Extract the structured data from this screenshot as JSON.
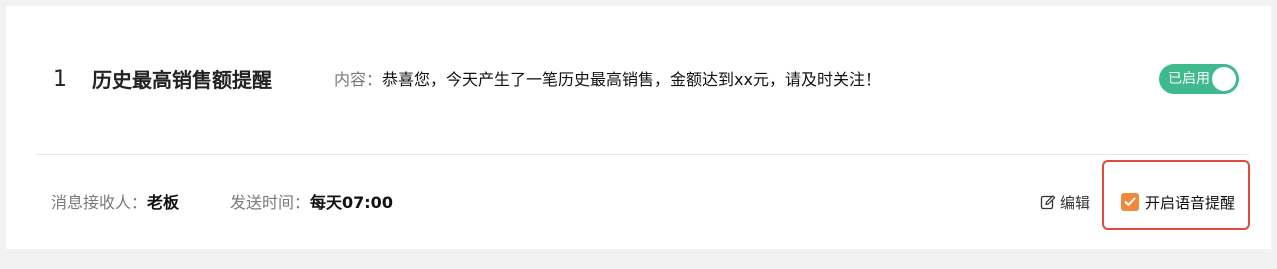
{
  "rule": {
    "index": "1",
    "title": "历史最高销售额提醒",
    "content_label": "内容：",
    "content_text": "恭喜您，今天产生了一笔历史最高销售，金额达到xx元，请及时关注！",
    "toggle_label": "已启用",
    "toggle_state": "on",
    "receiver_label": "消息接收人：",
    "receiver_value": "老板",
    "send_time_label": "发送时间：",
    "send_time_value": "每天07:00",
    "edit_label": "编辑",
    "edit_icon": "edit-icon",
    "voice_label": "开启语音提醒",
    "voice_checked": true
  },
  "colors": {
    "toggle_on": "#3fb98e",
    "checkbox": "#f0883e",
    "highlight_border": "#e04a3c",
    "label_gray": "#7a7a7a",
    "background": "#f2f2f2"
  }
}
